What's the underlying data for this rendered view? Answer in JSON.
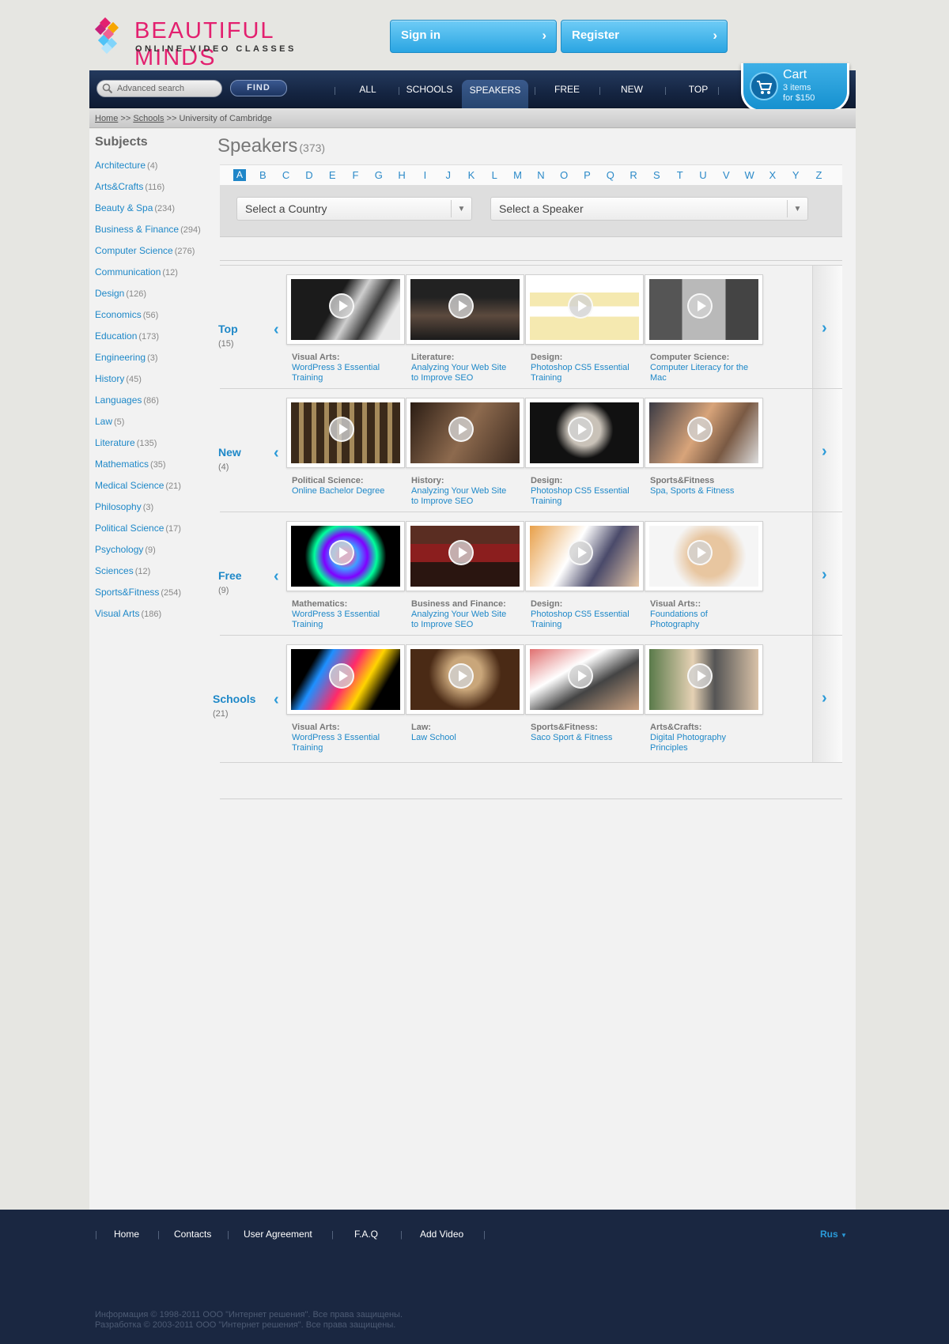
{
  "brand": {
    "name": "BEAUTIFUL MINDS",
    "tagline": "ONLINE VIDEO CLASSES"
  },
  "auth": {
    "signin_label": "Sign in",
    "register_label": "Register"
  },
  "search": {
    "placeholder": "Advanced search",
    "button_label": "FIND"
  },
  "nav": {
    "items": [
      "ALL",
      "SCHOOLS",
      "SPEAKERS",
      "FREE",
      "NEW",
      "TOP"
    ],
    "active": "SPEAKERS"
  },
  "cart": {
    "title": "Cart",
    "items": "3 items",
    "total": "for $150"
  },
  "breadcrumb": {
    "home": "Home",
    "sep1": ">>",
    "schools": "Schools",
    "sep2": ">>",
    "current": "University of Cambridge"
  },
  "sidebar": {
    "title": "Subjects",
    "items": [
      {
        "label": "Architecture",
        "count": "(4)"
      },
      {
        "label": "Arts&Crafts",
        "count": "(116)"
      },
      {
        "label": "Beauty & Spa",
        "count": "(234)"
      },
      {
        "label": "Business & Finance",
        "count": "(294)"
      },
      {
        "label": "Computer Science",
        "count": "(276)"
      },
      {
        "label": "Communication",
        "count": "(12)"
      },
      {
        "label": "Design",
        "count": "(126)"
      },
      {
        "label": "Economics",
        "count": "(56)"
      },
      {
        "label": "Education",
        "count": "(173)"
      },
      {
        "label": "Engineering",
        "count": "(3)"
      },
      {
        "label": "History",
        "count": "(45)"
      },
      {
        "label": "Languages",
        "count": "(86)"
      },
      {
        "label": "Law",
        "count": "(5)"
      },
      {
        "label": "Literature",
        "count": "(135)"
      },
      {
        "label": "Mathematics",
        "count": "(35)"
      },
      {
        "label": "Medical Science",
        "count": "(21)"
      },
      {
        "label": "Philosophy",
        "count": "(3)"
      },
      {
        "label": "Political Science",
        "count": "(17)"
      },
      {
        "label": "Psychology",
        "count": "(9)"
      },
      {
        "label": "Sciences",
        "count": "(12)"
      },
      {
        "label": "Sports&Fitness",
        "count": "(254)"
      },
      {
        "label": "Visual Arts",
        "count": "(186)"
      }
    ]
  },
  "page": {
    "title": "Speakers",
    "count": "(373)"
  },
  "alphabet": {
    "letters": [
      "A",
      "B",
      "C",
      "D",
      "E",
      "F",
      "G",
      "H",
      "I",
      "J",
      "K",
      "L",
      "M",
      "N",
      "O",
      "P",
      "Q",
      "R",
      "S",
      "T",
      "U",
      "V",
      "W",
      "X",
      "Y",
      "Z"
    ],
    "active": "A"
  },
  "filters": {
    "country": "Select a Country",
    "speaker": "Select a Speaker"
  },
  "rows": [
    {
      "name": "Top",
      "count": "(15)",
      "cards": [
        {
          "category": "Visual Arts:",
          "title": "WordPress 3 Essential Training",
          "thumb": "dark-hall"
        },
        {
          "category": "Literature:",
          "title": "Analyzing Your Web Site to Improve SEO",
          "thumb": "stage-scene"
        },
        {
          "category": "Design:",
          "title": "Photoshop CS5 Essential Training",
          "thumb": "calendar-screenshot"
        },
        {
          "category": "Computer Science:",
          "title": "Computer Literacy for the Mac",
          "thumb": "presenter"
        }
      ]
    },
    {
      "name": "New",
      "count": "(4)",
      "cards": [
        {
          "category": "Political Science:",
          "title": "Online Bachelor Degree",
          "thumb": "library-pillars"
        },
        {
          "category": "History:",
          "title": "Analyzing Your Web Site to Improve SEO",
          "thumb": "theatre-couple"
        },
        {
          "category": "Design:",
          "title": "Photoshop CS5 Essential Training",
          "thumb": "old-man"
        },
        {
          "category": "Sports&Fitness",
          "title": "Spa, Sports & Fitness",
          "thumb": "fitness-class"
        }
      ]
    },
    {
      "name": "Free",
      "count": "(9)",
      "cards": [
        {
          "category": "Mathematics:",
          "title": "WordPress 3 Essential Training",
          "thumb": "math-art"
        },
        {
          "category": "Business and Finance:",
          "title": "Analyzing Your Web Site to Improve SEO",
          "thumb": "parliament"
        },
        {
          "category": "Design:",
          "title": "Photoshop CS5 Essential Training",
          "thumb": "laptop-users"
        },
        {
          "category": "Visual Arts::",
          "title": "Foundations of Photography",
          "thumb": "photographer"
        }
      ]
    },
    {
      "name": "Schools",
      "count": "(21)",
      "cards": [
        {
          "category": "Visual Arts:",
          "title": "WordPress 3 Essential Training",
          "thumb": "bjork-art"
        },
        {
          "category": "Law:",
          "title": "Law School",
          "thumb": "reader"
        },
        {
          "category": "Sports&Fitness:",
          "title": "Saco Sport & Fitness",
          "thumb": "gym"
        },
        {
          "category": "Arts&Crafts:",
          "title": "Digital Photography Principles",
          "thumb": "two-men"
        }
      ]
    }
  ],
  "footer": {
    "links": [
      "Home",
      "Contacts",
      "User Agreement",
      "F.A.Q",
      "Add Video"
    ],
    "language": "Rus",
    "copyright1": "Информация © 1998-2011 ООО \"Интернет решения\". Все права защищены.",
    "copyright2": "Разработка © 2003-2011 ООО \"Интернет решения\". Все права защищены."
  },
  "colors": {
    "accent": "#1e88c8",
    "brand_pink": "#e3206f",
    "nav_dark": "#152542",
    "footer": "#1a2741",
    "button_blue": "#2aa5e2"
  }
}
